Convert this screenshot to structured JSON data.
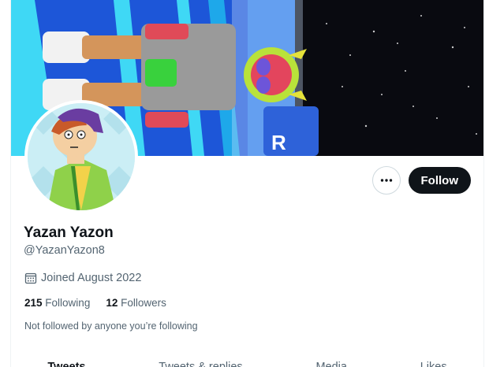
{
  "profile": {
    "display_name": "Yazan Yazon",
    "handle": "@YazanYazon8",
    "joined": "Joined August 2022",
    "following_count": "215",
    "following_label": "Following",
    "followers_count": "12",
    "followers_label": "Followers",
    "follow_note": "Not followed by anyone you’re following"
  },
  "actions": {
    "follow_label": "Follow",
    "more_icon": "more-horizontal-icon"
  },
  "icons": {
    "calendar": "calendar-icon"
  },
  "tabs": [
    {
      "label": "Tweets",
      "active": true
    },
    {
      "label": "Tweets & replies",
      "active": false
    },
    {
      "label": "Media",
      "active": false
    },
    {
      "label": "Likes",
      "active": false
    }
  ],
  "colors": {
    "primary_text": "#0f1419",
    "secondary_text": "#536471",
    "follow_button_bg": "#0f1419",
    "border": "#cfd9de"
  }
}
